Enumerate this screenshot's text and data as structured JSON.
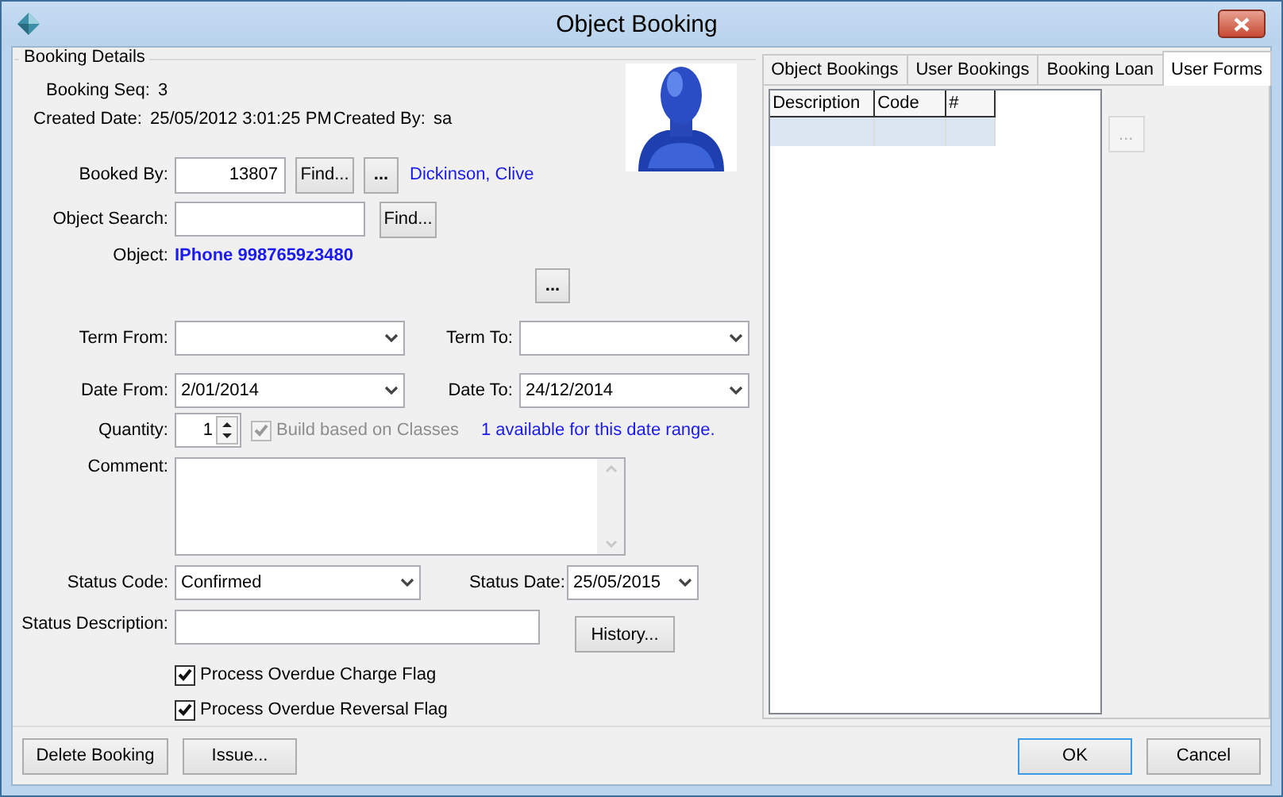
{
  "window": {
    "title": "Object Booking"
  },
  "group_title": "Booking Details",
  "booking_seq": {
    "label": "Booking Seq:",
    "value": "3"
  },
  "created": {
    "label": "Created Date:",
    "value": "25/05/2012 3:01:25 PM",
    "by_label": "Created By:",
    "by_value": "sa"
  },
  "booked_by": {
    "label": "Booked By:",
    "value": "13807",
    "find": "Find...",
    "more": "...",
    "name": "Dickinson, Clive"
  },
  "object_search": {
    "label": "Object Search:",
    "find": "Find..."
  },
  "object": {
    "label": "Object:",
    "value": "IPhone 9987659z3480",
    "more": "..."
  },
  "term_from": {
    "label": "Term From:"
  },
  "term_to": {
    "label": "Term To:"
  },
  "date_from": {
    "label": "Date From:",
    "value": "2/01/2014"
  },
  "date_to": {
    "label": "Date To:",
    "value": "24/12/2014"
  },
  "quantity": {
    "label": "Quantity:",
    "value": "1"
  },
  "build_classes": {
    "label": "Build based on Classes",
    "checked": true,
    "disabled": true
  },
  "availability": "1 available for this date range.",
  "comment": {
    "label": "Comment:"
  },
  "status_code": {
    "label": "Status Code:",
    "value": "Confirmed"
  },
  "status_date": {
    "label": "Status Date:",
    "value": "25/05/2015"
  },
  "status_description": {
    "label": "Status Description:"
  },
  "history": "History...",
  "flags": [
    {
      "label": "Process Overdue Charge Flag",
      "checked": true
    },
    {
      "label": "Process Overdue Reversal Flag",
      "checked": true
    }
  ],
  "buttons_left": [
    "Delete Booking",
    "Issue..."
  ],
  "tabs": [
    {
      "label": "Object Bookings",
      "selected": false
    },
    {
      "label": "User Bookings",
      "selected": false
    },
    {
      "label": "Booking Loan",
      "selected": false
    },
    {
      "label": "User Forms",
      "selected": true
    }
  ],
  "table": {
    "columns": [
      "Description",
      "Code",
      "#"
    ],
    "rows": [
      {
        "selected": true
      }
    ]
  },
  "side_button": {
    "label": "...",
    "disabled": true
  },
  "buttons_right": [
    {
      "label": "OK",
      "default": true
    },
    {
      "label": "Cancel",
      "default": false
    }
  ]
}
